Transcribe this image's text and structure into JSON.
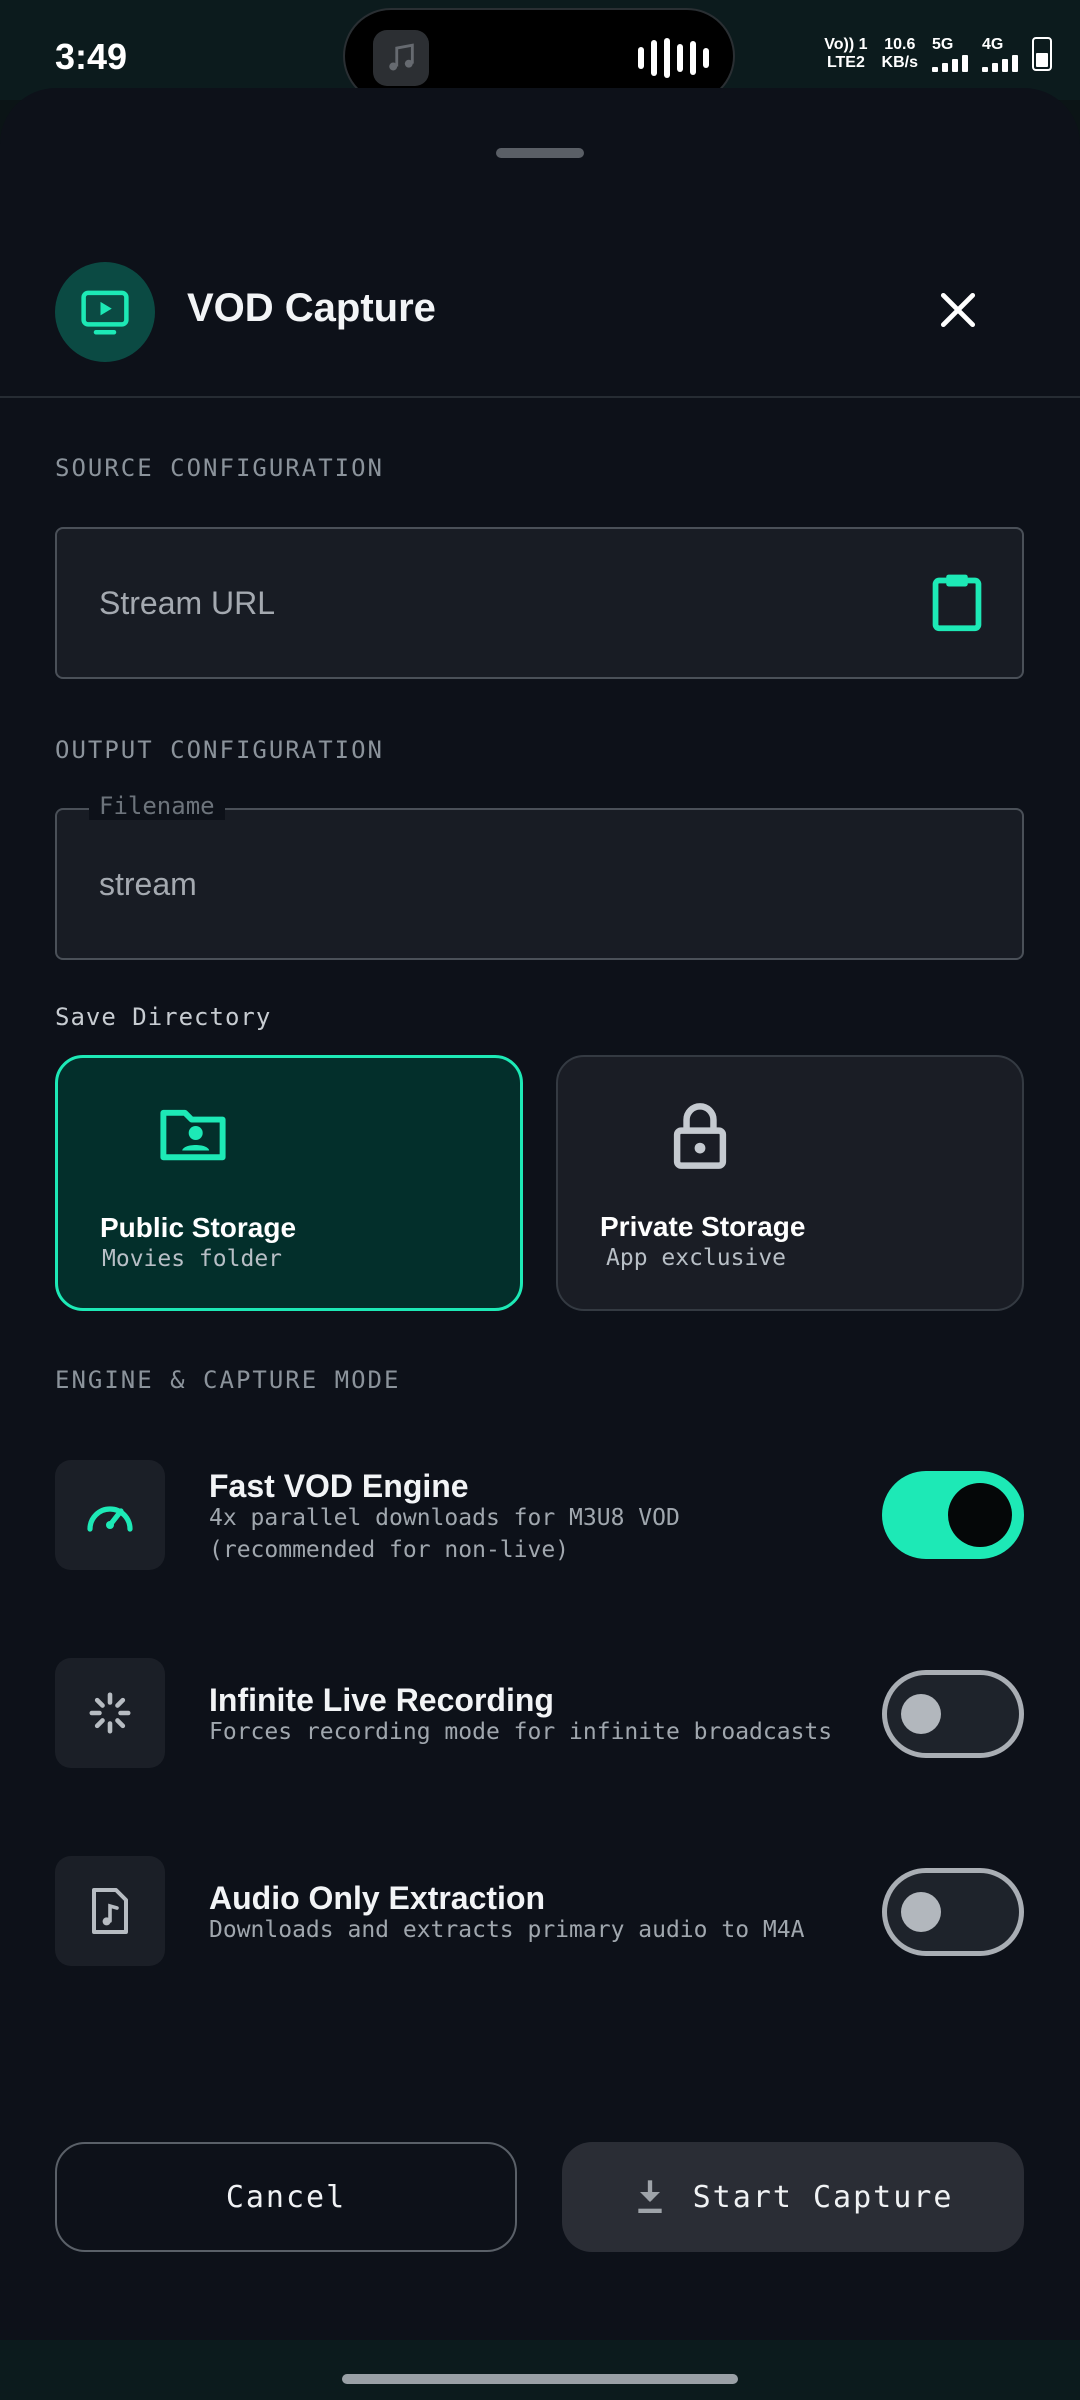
{
  "status_bar": {
    "time": "3:49",
    "volte_top": "Vo)) 1",
    "volte_bottom": "LTE2",
    "speed_value": "10.6",
    "speed_unit": "KB/s",
    "net1": "5G",
    "net2": "4G",
    "battery_level": 0.5
  },
  "header": {
    "title": "VOD Capture",
    "icon": "tv-icon",
    "close_icon": "close-icon"
  },
  "source": {
    "section_label": "SOURCE CONFIGURATION",
    "url_placeholder": "Stream URL",
    "paste_icon": "clipboard-icon"
  },
  "output": {
    "section_label": "OUTPUT CONFIGURATION",
    "filename_label": "Filename",
    "filename_value": "stream",
    "save_directory_label": "Save Directory",
    "options": [
      {
        "name": "Public Storage",
        "desc": "Movies folder",
        "selected": true,
        "icon": "folder-user-icon"
      },
      {
        "name": "Private Storage",
        "desc": "App exclusive",
        "selected": false,
        "icon": "lock-icon"
      }
    ]
  },
  "engine": {
    "section_label": "ENGINE & CAPTURE MODE",
    "options": [
      {
        "title": "Fast VOD Engine",
        "desc": "4x parallel downloads for M3U8 VOD (recommended for non-live)",
        "enabled": true,
        "icon": "speedometer-icon"
      },
      {
        "title": "Infinite Live Recording",
        "desc": "Forces recording mode for infinite broadcasts",
        "enabled": false,
        "icon": "loading-spinner-icon"
      },
      {
        "title": "Audio Only Extraction",
        "desc": "Downloads and extracts primary audio to M4A",
        "enabled": false,
        "icon": "music-file-icon"
      }
    ]
  },
  "actions": {
    "cancel_label": "Cancel",
    "start_label": "Start Capture",
    "start_icon": "download-icon"
  },
  "colors": {
    "accent": "#1de9b6",
    "background": "#0d1119"
  }
}
